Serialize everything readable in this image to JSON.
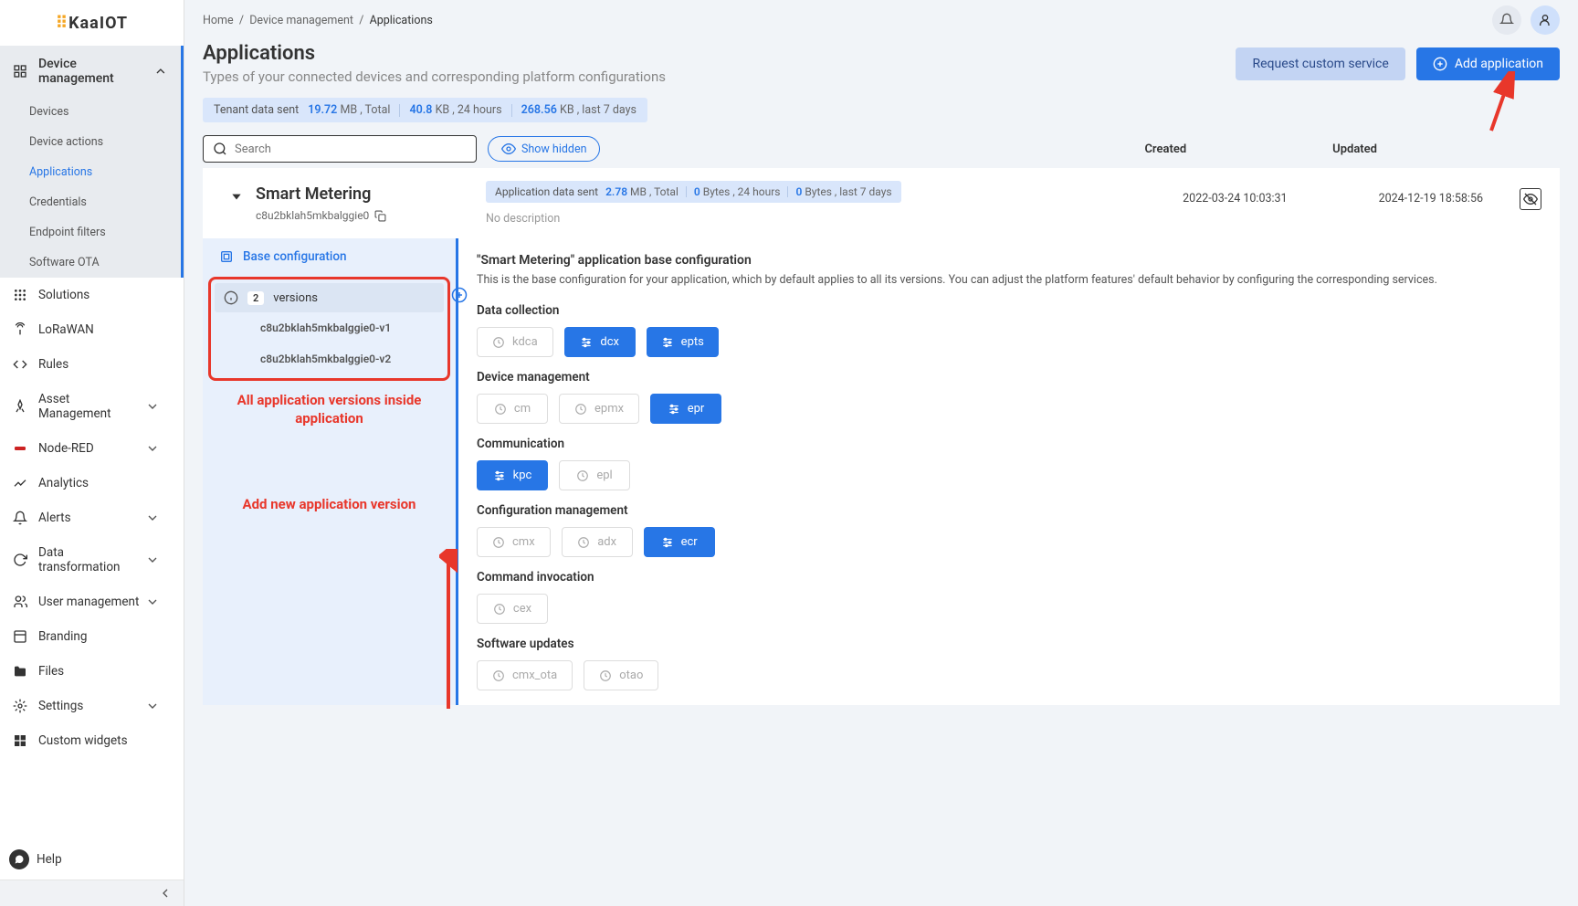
{
  "logo": "KaaIOT",
  "breadcrumb": {
    "home": "Home",
    "dm": "Device management",
    "apps": "Applications"
  },
  "page": {
    "title": "Applications",
    "subtitle": "Types of your connected devices and corresponding platform configurations"
  },
  "buttons": {
    "request_custom": "Request custom service",
    "add_app": "Add application"
  },
  "tenant": {
    "label": "Tenant data sent",
    "total_val": "19.72",
    "total_unit": "MB , Total",
    "day_val": "40.8",
    "day_unit": "KB , 24 hours",
    "week_val": "268.56",
    "week_unit": "KB , last 7 days"
  },
  "search": {
    "placeholder": "Search"
  },
  "show_hidden": "Show hidden",
  "columns": {
    "created": "Created",
    "updated": "Updated"
  },
  "sidebar": {
    "device_mgmt": "Device management",
    "subs": {
      "devices": "Devices",
      "actions": "Device actions",
      "applications": "Applications",
      "credentials": "Credentials",
      "filters": "Endpoint filters",
      "ota": "Software OTA"
    },
    "solutions": "Solutions",
    "lorawan": "LoRaWAN",
    "rules": "Rules",
    "asset": "Asset Management",
    "nodered": "Node-RED",
    "analytics": "Analytics",
    "alerts": "Alerts",
    "datatrans": "Data transformation",
    "usermgmt": "User management",
    "branding": "Branding",
    "files": "Files",
    "settings": "Settings",
    "widgets": "Custom widgets",
    "help": "Help"
  },
  "app": {
    "name": "Smart Metering",
    "id": "c8u2bklah5mkbalggie0",
    "data_label": "Application data sent",
    "total_val": "2.78",
    "total_unit": "MB , Total",
    "day_val": "0",
    "day_unit": "Bytes , 24 hours",
    "week_val": "0",
    "week_unit": "Bytes , last 7 days",
    "no_desc": "No description",
    "created": "2022-03-24 10:03:31",
    "updated": "2024-12-19 18:58:56"
  },
  "detail": {
    "base_config": "Base configuration",
    "versions_label": "versions",
    "versions_count": "2",
    "v1": "c8u2bklah5mkbalggie0-v1",
    "v2": "c8u2bklah5mkbalggie0-v2",
    "anno_versions": "All application versions inside application",
    "anno_add": "Add new application version",
    "conf_title": "\"Smart Metering\" application base configuration",
    "conf_desc": "This is the base configuration for your application, which by default applies to all its versions. You can adjust the platform features' default behavior by configuring the corresponding services."
  },
  "sections": {
    "data_collection": {
      "label": "Data collection",
      "chips": [
        {
          "name": "kdca",
          "active": false
        },
        {
          "name": "dcx",
          "active": true
        },
        {
          "name": "epts",
          "active": true
        }
      ]
    },
    "device_mgmt": {
      "label": "Device management",
      "chips": [
        {
          "name": "cm",
          "active": false
        },
        {
          "name": "epmx",
          "active": false
        },
        {
          "name": "epr",
          "active": true
        }
      ]
    },
    "communication": {
      "label": "Communication",
      "chips": [
        {
          "name": "kpc",
          "active": true
        },
        {
          "name": "epl",
          "active": false
        }
      ]
    },
    "config_mgmt": {
      "label": "Configuration management",
      "chips": [
        {
          "name": "cmx",
          "active": false
        },
        {
          "name": "adx",
          "active": false
        },
        {
          "name": "ecr",
          "active": true
        }
      ]
    },
    "command": {
      "label": "Command invocation",
      "chips": [
        {
          "name": "cex",
          "active": false
        }
      ]
    },
    "software": {
      "label": "Software updates",
      "chips": [
        {
          "name": "cmx_ota",
          "active": false
        },
        {
          "name": "otao",
          "active": false
        }
      ]
    }
  }
}
